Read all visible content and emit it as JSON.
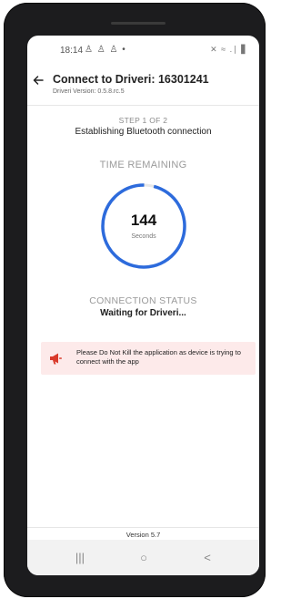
{
  "status_bar": {
    "time": "18:14",
    "left_icons": "♙ ♙ ♙ •",
    "right_icons": "✕ ≈ .∣ ▋"
  },
  "header": {
    "title": "Connect to Driveri: 16301241",
    "subtitle": "Driveri Version: 0.5.8.rc.5"
  },
  "step": {
    "label": "STEP 1 OF 2",
    "title": "Establishing Bluetooth connection"
  },
  "timer": {
    "label": "TIME REMAINING",
    "value": "144",
    "unit": "Seconds",
    "progress": 0.96,
    "color": "#2d6bdc"
  },
  "connection": {
    "label": "CONNECTION STATUS",
    "value": "Waiting for Driveri..."
  },
  "warning": {
    "text": "Please Do Not Kill the application as device is trying to connect with the app",
    "icon": "megaphone-icon",
    "color": "#d93a2b",
    "background": "#fdeaea"
  },
  "footer": {
    "version": "Version 5.7"
  },
  "navbar": {
    "recents": "|||",
    "home": "○",
    "back": "<"
  }
}
